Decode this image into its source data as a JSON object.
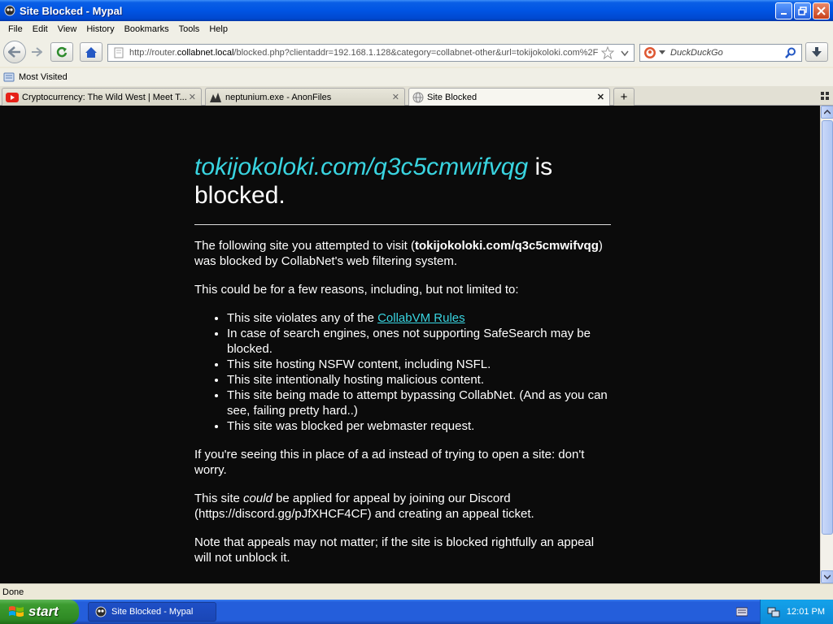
{
  "window": {
    "title": "Site Blocked - Mypal"
  },
  "menu": [
    {
      "label": "File"
    },
    {
      "label": "Edit"
    },
    {
      "label": "View"
    },
    {
      "label": "History"
    },
    {
      "label": "Bookmarks"
    },
    {
      "label": "Tools"
    },
    {
      "label": "Help"
    }
  ],
  "nav": {
    "url_prefix": "http://router.",
    "url_host": "collabnet.local",
    "url_rest": "/blocked.php?clientaddr=192.168.1.128&category=collabnet-other&url=tokijokoloki.com%2F",
    "search_placeholder": "DuckDuckGo"
  },
  "bookmarks": {
    "most_visited": "Most Visited"
  },
  "tabs": [
    {
      "label": "Cryptocurrency: The Wild West | Meet T..."
    },
    {
      "label": "neptunium.exe - AnonFiles"
    },
    {
      "label": "Site Blocked"
    }
  ],
  "page": {
    "site": "tokijokoloki.com/q3c5cmwifvqg",
    "headline_suffix": " is blocked.",
    "p1_before": "The following site you attempted to visit (",
    "p1_site": "tokijokoloki.com/q3c5cmwifvqg",
    "p1_after": ") was blocked by CollabNet's web filtering system.",
    "p2": "This could be for a few reasons, including, but not limited to:",
    "reason1_before": "This site violates any of the ",
    "reason1_link": "CollabVM Rules",
    "reasons": [
      "In case of search engines, ones not supporting SafeSearch may be blocked.",
      "This site hosting NSFW content, including NSFL.",
      "This site intentionally hosting malicious content.",
      "This site being made to attempt bypassing CollabNet. (And as you can see, failing pretty hard..)",
      "This site was blocked per webmaster request."
    ],
    "p3": "If you're seeing this in place of a ad instead of trying to open a site: don't worry.",
    "p4_before": "This site ",
    "p4_em": "could",
    "p4_after": " be applied for appeal by joining our Discord (https://discord.gg/pJfXHCF4CF) and creating an appeal ticket.",
    "p5": "Note that appeals may not matter; if the site is blocked rightfully an appeal will not unblock it."
  },
  "status": {
    "text": "Done"
  },
  "taskbar": {
    "start": "start",
    "task": "Site Blocked - Mypal",
    "clock": "12:01 PM"
  },
  "colors": {
    "titlebar": "#0054e3",
    "page_bg": "#0b0b0b",
    "accent": "#39d4e0",
    "start_green": "#3c9c30"
  }
}
